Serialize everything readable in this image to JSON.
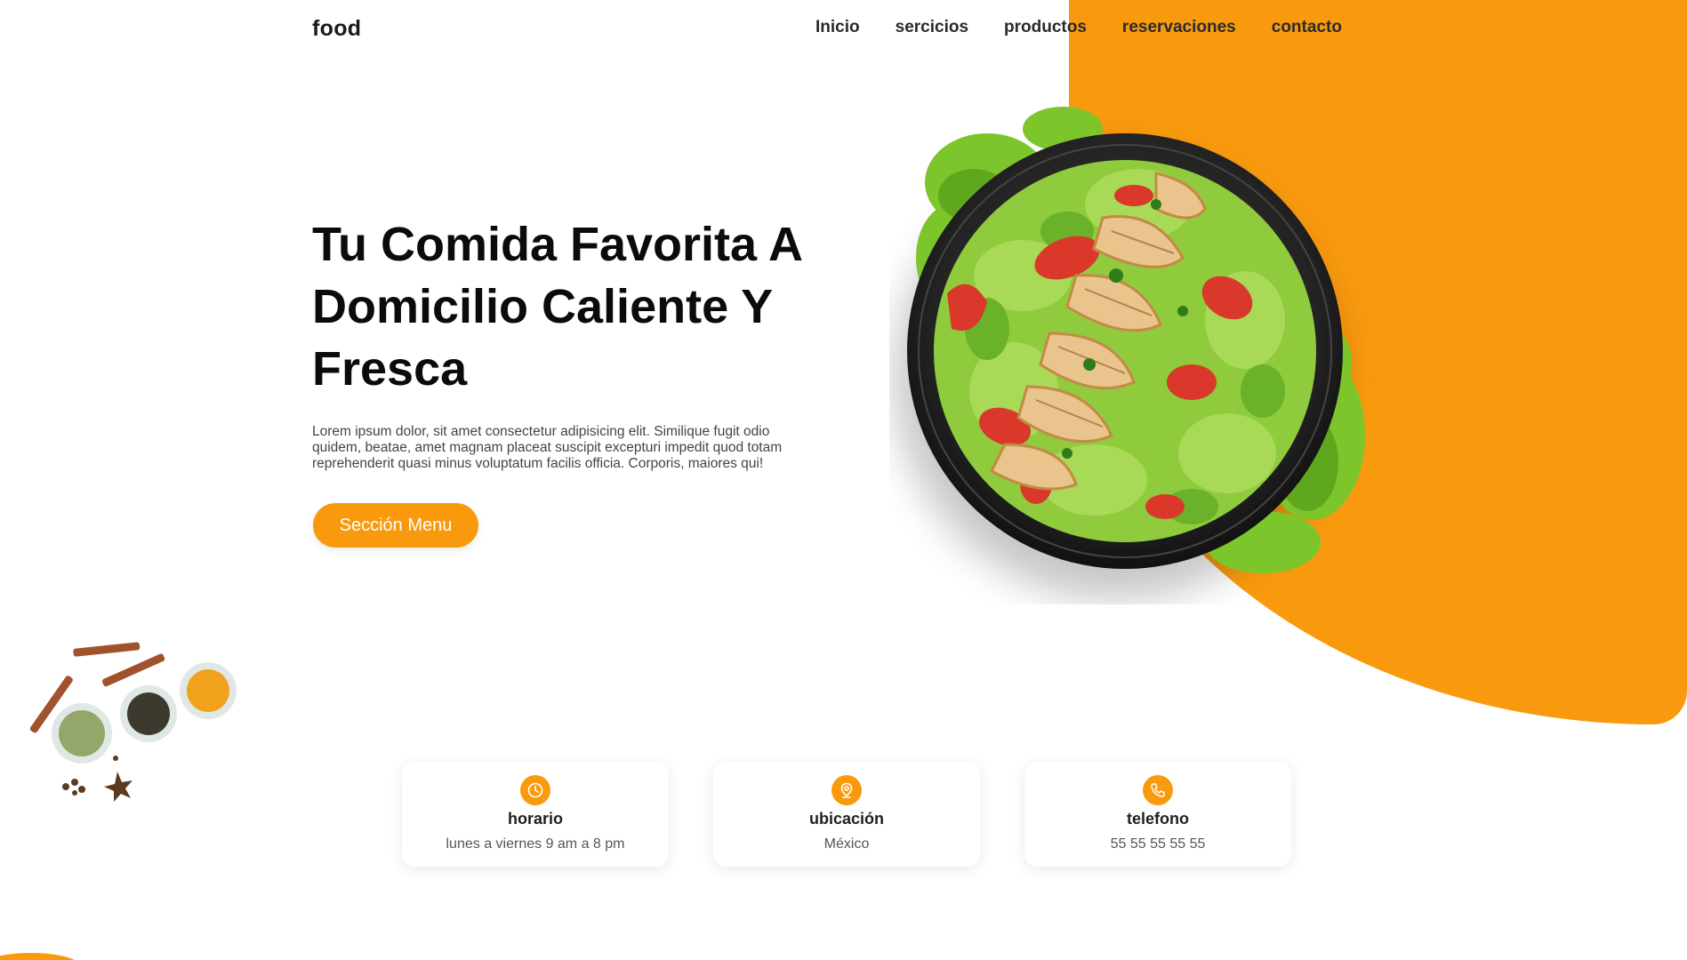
{
  "brand": {
    "logo": "food"
  },
  "nav": {
    "items": [
      "Inicio",
      "sercicios",
      "productos",
      "reservaciones",
      "contacto"
    ]
  },
  "hero": {
    "title": "Tu Comida Favorita A Domicilio Caliente Y Fresca",
    "description": "Lorem ipsum dolor, sit amet consectetur adipisicing elit. Similique fugit odio quidem, beatae, amet magnam placeat suscipit excepturi impedit quod totam reprehenderit quasi minus voluptatum facilis officia. Corporis, maiores qui!",
    "button_label": "Sección Menu"
  },
  "info_cards": [
    {
      "icon": "clock-icon",
      "title": "horario",
      "text": "lunes a viernes 9 am a 8 pm"
    },
    {
      "icon": "location-pin-icon",
      "title": "ubicación",
      "text": "México"
    },
    {
      "icon": "phone-icon",
      "title": "telefono",
      "text": "55 55 55 55 55"
    }
  ],
  "colors": {
    "accent": "#f99a0e",
    "text_dark": "#111111",
    "background": "#ffffff"
  },
  "images": {
    "hero": "salad-bowl-image",
    "decoration": "spices-image"
  }
}
